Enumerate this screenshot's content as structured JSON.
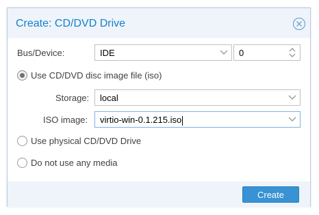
{
  "dialog": {
    "title": "Create: CD/DVD Drive",
    "close_icon": "close-circle-icon"
  },
  "bus_device": {
    "label": "Bus/Device:",
    "bus_value": "IDE",
    "device_value": "0"
  },
  "iso_option": {
    "label": "Use CD/DVD disc image file (iso)",
    "checked": true
  },
  "storage": {
    "label": "Storage:",
    "value": "local"
  },
  "iso_image": {
    "label": "ISO image:",
    "value": "virtio-win-0.1.215.iso"
  },
  "physical_option": {
    "label": "Use physical CD/DVD Drive",
    "checked": false
  },
  "no_media_option": {
    "label": "Do not use any media",
    "checked": false
  },
  "footer": {
    "create_label": "Create"
  },
  "colors": {
    "accent": "#157fcc",
    "button": "#3892d4",
    "header_bg": "#eef4fa"
  }
}
